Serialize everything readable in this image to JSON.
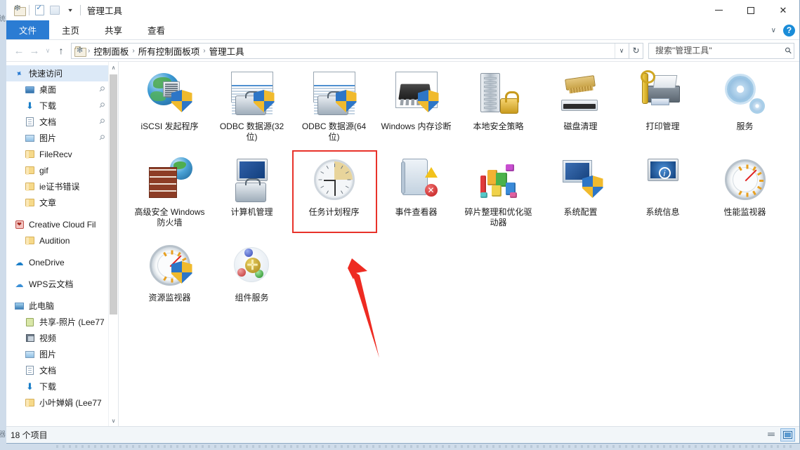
{
  "window": {
    "title": "管理工具",
    "quick_access": [
      {
        "name": "folder-settings-icon",
        "label": "管理工具"
      },
      {
        "name": "properties-icon",
        "label": "属性"
      },
      {
        "name": "new-folder-icon",
        "label": "新建文件夹"
      },
      {
        "name": "customize-qat-caret",
        "label": "自定义快速访问工具栏"
      }
    ],
    "controls": {
      "minimize": "最小化",
      "maximize": "最大化",
      "close": "关闭"
    }
  },
  "ribbon": {
    "tabs": [
      {
        "label": "文件",
        "active": true
      },
      {
        "label": "主页",
        "active": false
      },
      {
        "label": "共享",
        "active": false
      },
      {
        "label": "查看",
        "active": false
      }
    ],
    "collapse_label": "∨",
    "help_label": "?"
  },
  "address": {
    "back_label": "←",
    "forward_label": "→",
    "recent_label": "∨",
    "up_label": "↑",
    "breadcrumbs": [
      "控制面板",
      "所有控制面板项",
      "管理工具"
    ],
    "separator": "›",
    "dropdown_label": "∨",
    "refresh_label": "↻"
  },
  "search": {
    "placeholder": "搜索\"管理工具\"",
    "value": "",
    "icon": "search-icon"
  },
  "sidebar": {
    "items": [
      {
        "label": "快速访问",
        "icon": "pin-icon",
        "indent": 0,
        "selected": true,
        "pinned": false
      },
      {
        "label": "桌面",
        "icon": "desktop-icon",
        "indent": 1,
        "selected": false,
        "pinned": true
      },
      {
        "label": "下载",
        "icon": "download-icon",
        "indent": 1,
        "selected": false,
        "pinned": true
      },
      {
        "label": "文档",
        "icon": "document-icon",
        "indent": 1,
        "selected": false,
        "pinned": true
      },
      {
        "label": "图片",
        "icon": "pictures-icon",
        "indent": 1,
        "selected": false,
        "pinned": true
      },
      {
        "label": "FileRecv",
        "icon": "folder-icon",
        "indent": 1,
        "selected": false,
        "pinned": false
      },
      {
        "label": "gif",
        "icon": "folder-icon",
        "indent": 1,
        "selected": false,
        "pinned": false
      },
      {
        "label": "ie证书错误",
        "icon": "folder-icon",
        "indent": 1,
        "selected": false,
        "pinned": false
      },
      {
        "label": "文章",
        "icon": "folder-icon",
        "indent": 1,
        "selected": false,
        "pinned": false
      },
      {
        "label": "Creative Cloud Fil",
        "icon": "creative-cloud-icon",
        "indent": 0,
        "selected": false,
        "pinned": false
      },
      {
        "label": "Audition",
        "icon": "folder-icon",
        "indent": 1,
        "selected": false,
        "pinned": false
      },
      {
        "label": "OneDrive",
        "icon": "onedrive-icon",
        "indent": 0,
        "selected": false,
        "pinned": false
      },
      {
        "label": "WPS云文档",
        "icon": "wps-cloud-icon",
        "indent": 0,
        "selected": false,
        "pinned": false
      },
      {
        "label": "此电脑",
        "icon": "this-pc-icon",
        "indent": 0,
        "selected": false,
        "pinned": false
      },
      {
        "label": "共享-照片 (Lee77",
        "icon": "shared-folder-icon",
        "indent": 1,
        "selected": false,
        "pinned": false
      },
      {
        "label": "视频",
        "icon": "videos-icon",
        "indent": 1,
        "selected": false,
        "pinned": false
      },
      {
        "label": "图片",
        "icon": "pictures-icon",
        "indent": 1,
        "selected": false,
        "pinned": false
      },
      {
        "label": "文档",
        "icon": "document-icon",
        "indent": 1,
        "selected": false,
        "pinned": false
      },
      {
        "label": "下载",
        "icon": "download-icon",
        "indent": 1,
        "selected": false,
        "pinned": false
      },
      {
        "label": "小叶婵娟 (Lee77",
        "icon": "folder-icon",
        "indent": 1,
        "selected": false,
        "pinned": false
      }
    ],
    "scroll_up_label": "∧",
    "scroll_down_label": "∨"
  },
  "content": {
    "items": [
      {
        "label": "iSCSI 发起程序",
        "art": "iscsi",
        "highlighted": false
      },
      {
        "label": "ODBC 数据源(32 位)",
        "art": "odbc",
        "highlighted": false
      },
      {
        "label": "ODBC 数据源(64 位)",
        "art": "odbc",
        "highlighted": false
      },
      {
        "label": "Windows 内存诊断",
        "art": "memdiag",
        "highlighted": false
      },
      {
        "label": "本地安全策略",
        "art": "localsec",
        "highlighted": false
      },
      {
        "label": "磁盘清理",
        "art": "diskclean",
        "highlighted": false
      },
      {
        "label": "打印管理",
        "art": "printmgmt",
        "highlighted": false
      },
      {
        "label": "服务",
        "art": "services",
        "highlighted": false
      },
      {
        "label": "高级安全 Windows 防火墙",
        "art": "firewall",
        "highlighted": false
      },
      {
        "label": "计算机管理",
        "art": "compmgmt",
        "highlighted": false
      },
      {
        "label": "任务计划程序",
        "art": "taskscheduler",
        "highlighted": true
      },
      {
        "label": "事件查看器",
        "art": "eventviewer",
        "highlighted": false
      },
      {
        "label": "碎片整理和优化驱动器",
        "art": "defrag",
        "highlighted": false
      },
      {
        "label": "系统配置",
        "art": "msconfig",
        "highlighted": false
      },
      {
        "label": "系统信息",
        "art": "sysinfo",
        "highlighted": false
      },
      {
        "label": "性能监视器",
        "art": "perfmon",
        "highlighted": false
      },
      {
        "label": "资源监视器",
        "art": "resmon",
        "highlighted": false
      },
      {
        "label": "组件服务",
        "art": "comsvc",
        "highlighted": false
      }
    ],
    "annotation": {
      "highlight_color": "#e8322a",
      "arrow_color": "#ee2b22",
      "target": "任务计划程序"
    }
  },
  "statusbar": {
    "item_count_text": "18 个项目",
    "views": [
      {
        "name": "details-view",
        "label": "详细信息",
        "active": false
      },
      {
        "name": "large-icons-view",
        "label": "大图标",
        "active": true
      }
    ]
  }
}
